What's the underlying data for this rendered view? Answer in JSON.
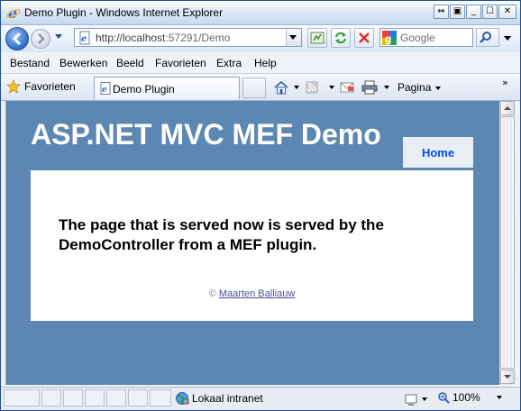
{
  "window": {
    "title": "Demo Plugin - Windows Internet Explorer"
  },
  "address_bar": {
    "url_host": "http://localhost",
    "url_rest": ":57291/Demo",
    "search_placeholder": "Google"
  },
  "menubar": {
    "items": [
      "Bestand",
      "Bewerken",
      "Beeld",
      "Favorieten",
      "Extra",
      "Help"
    ]
  },
  "favbar": {
    "favorites_label": "Favorieten",
    "tab_label": "Demo Plugin",
    "page_label": "Pagina"
  },
  "page": {
    "site_title": "ASP.NET MVC MEF Demo",
    "nav_home": "Home",
    "main_text": "The page that is served now is served by the DemoController from a MEF plugin.",
    "footer_copyright": "©",
    "footer_author": "Maarten Balliauw"
  },
  "statusbar": {
    "zone": "Lokaal intranet",
    "zoom": "100%"
  },
  "colors": {
    "page_background": "#5c87b2",
    "home_link": "#034af3"
  }
}
